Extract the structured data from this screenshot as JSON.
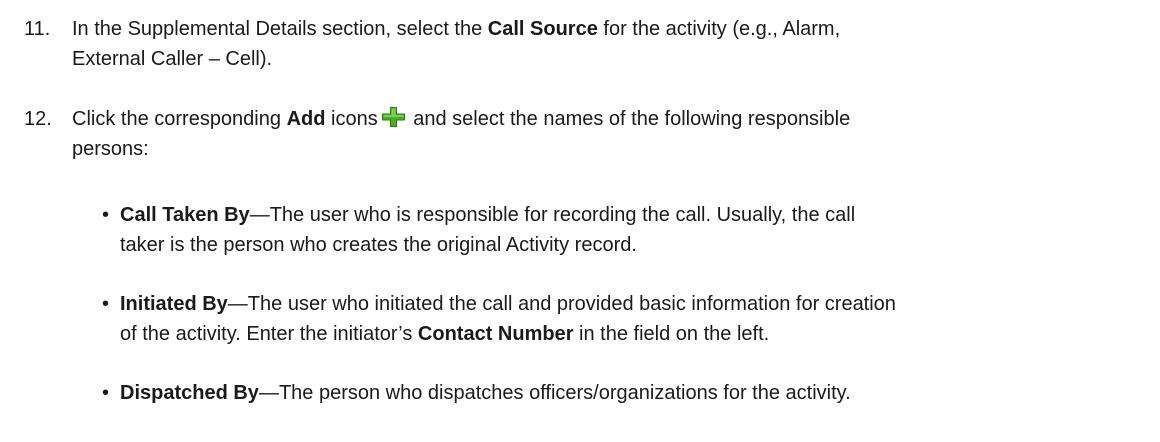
{
  "steps": [
    {
      "number": "11.",
      "line1_prefix": "In the Supplemental Details section, select the ",
      "line1_bold": "Call Source",
      "line1_suffix": " for the activity (e.g., Alarm,",
      "line2": "External Caller – Cell)."
    },
    {
      "number": "12.",
      "prefix": "Click the corresponding ",
      "bold": "Add",
      "after_bold": " icons",
      "icon": "green-plus-icon",
      "suffix": " and select the names of the following responsible",
      "line2": "persons:"
    }
  ],
  "bullets": [
    {
      "term": "Call Taken By",
      "line1": "—The user who is responsible for recording the call. Usually, the call",
      "line2": "taker is the person who creates the original Activity record."
    },
    {
      "term": "Initiated By",
      "line1": "—The user who initiated the call and provided basic information for creation",
      "line2_prefix": "of the activity. Enter the initiator’s ",
      "line2_bold": "Contact Number",
      "line2_suffix": " in the field on the left."
    },
    {
      "term": "Dispatched By",
      "line1": "—The person who dispatches officers/organizations for the activity."
    }
  ],
  "bullet_glyph": "•",
  "colors": {
    "text": "#1a1a1a",
    "icon_green": "#4caf1f",
    "icon_green_dark": "#2e7d12"
  }
}
